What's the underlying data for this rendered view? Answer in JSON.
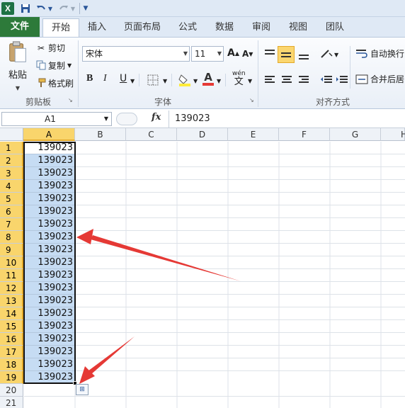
{
  "qat": {
    "logo": "X",
    "save_icon": "save-icon",
    "undo_icon": "undo-icon",
    "redo_icon": "redo-icon",
    "customize_icon": "customize-icon"
  },
  "tabs": [
    {
      "label": "文件"
    },
    {
      "label": "开始"
    },
    {
      "label": "插入"
    },
    {
      "label": "页面布局"
    },
    {
      "label": "公式"
    },
    {
      "label": "数据"
    },
    {
      "label": "审阅"
    },
    {
      "label": "视图"
    },
    {
      "label": "团队"
    }
  ],
  "clipboard": {
    "paste": "粘贴",
    "cut": "剪切",
    "copy": "复制",
    "format_painter": "格式刷",
    "group": "剪贴板"
  },
  "font": {
    "name": "宋体",
    "size": "11",
    "bold": "B",
    "italic": "I",
    "underline": "U",
    "grow": "A",
    "shrink": "A",
    "color_letter": "A",
    "wen": "wén",
    "wen_char": "文",
    "group": "字体"
  },
  "alignment": {
    "wrap": "自动换行",
    "merge": "合并后居",
    "group": "对齐方式"
  },
  "formula_bar": {
    "name_box": "A1",
    "fx": "fx",
    "value": "139023"
  },
  "columns": [
    "A",
    "B",
    "C",
    "D",
    "E",
    "F",
    "G",
    "H"
  ],
  "rows": [
    "1",
    "2",
    "3",
    "4",
    "5",
    "6",
    "7",
    "8",
    "9",
    "10",
    "11",
    "12",
    "13",
    "14",
    "15",
    "16",
    "17",
    "18",
    "19",
    "20",
    "21"
  ],
  "cells": [
    "139023",
    "139023",
    "139023",
    "139023",
    "139023",
    "139023",
    "139023",
    "139023",
    "139023",
    "139023",
    "139023",
    "139023",
    "139023",
    "139023",
    "139023",
    "139023",
    "139023",
    "139023",
    "139023"
  ],
  "colors": {
    "accent": "#2d7a3a",
    "selection": "#c6dcf3",
    "header_selected": "#f9d56c",
    "arrow": "#e53935"
  }
}
